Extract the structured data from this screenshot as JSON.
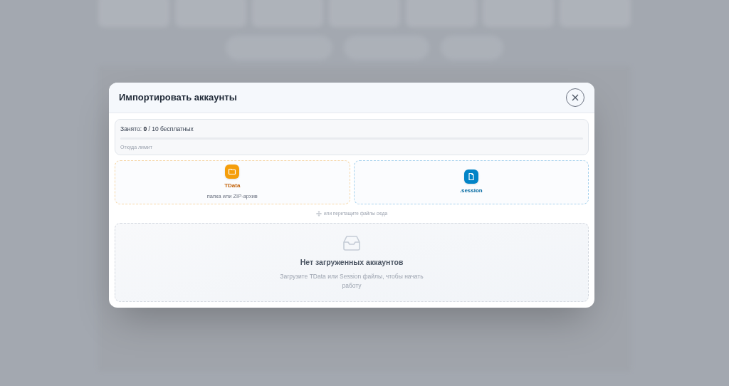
{
  "modal": {
    "title": "Импортировать аккаунты",
    "usage": {
      "label": "Занято:",
      "used": "0",
      "total": "/ 10 бесплатных",
      "level": 0,
      "link": "Откуда лимит"
    },
    "sources": [
      {
        "kind": "tdata",
        "title": "TData",
        "subtitle": "папка или ZIP-архив"
      },
      {
        "kind": "session",
        "title": ".session"
      }
    ],
    "drag_hint": "или перетащите файлы сюда",
    "empty": {
      "title": "Нет загруженных аккаунтов",
      "text": "Загрузите TData или Session файлы, чтобы начать работу"
    }
  }
}
